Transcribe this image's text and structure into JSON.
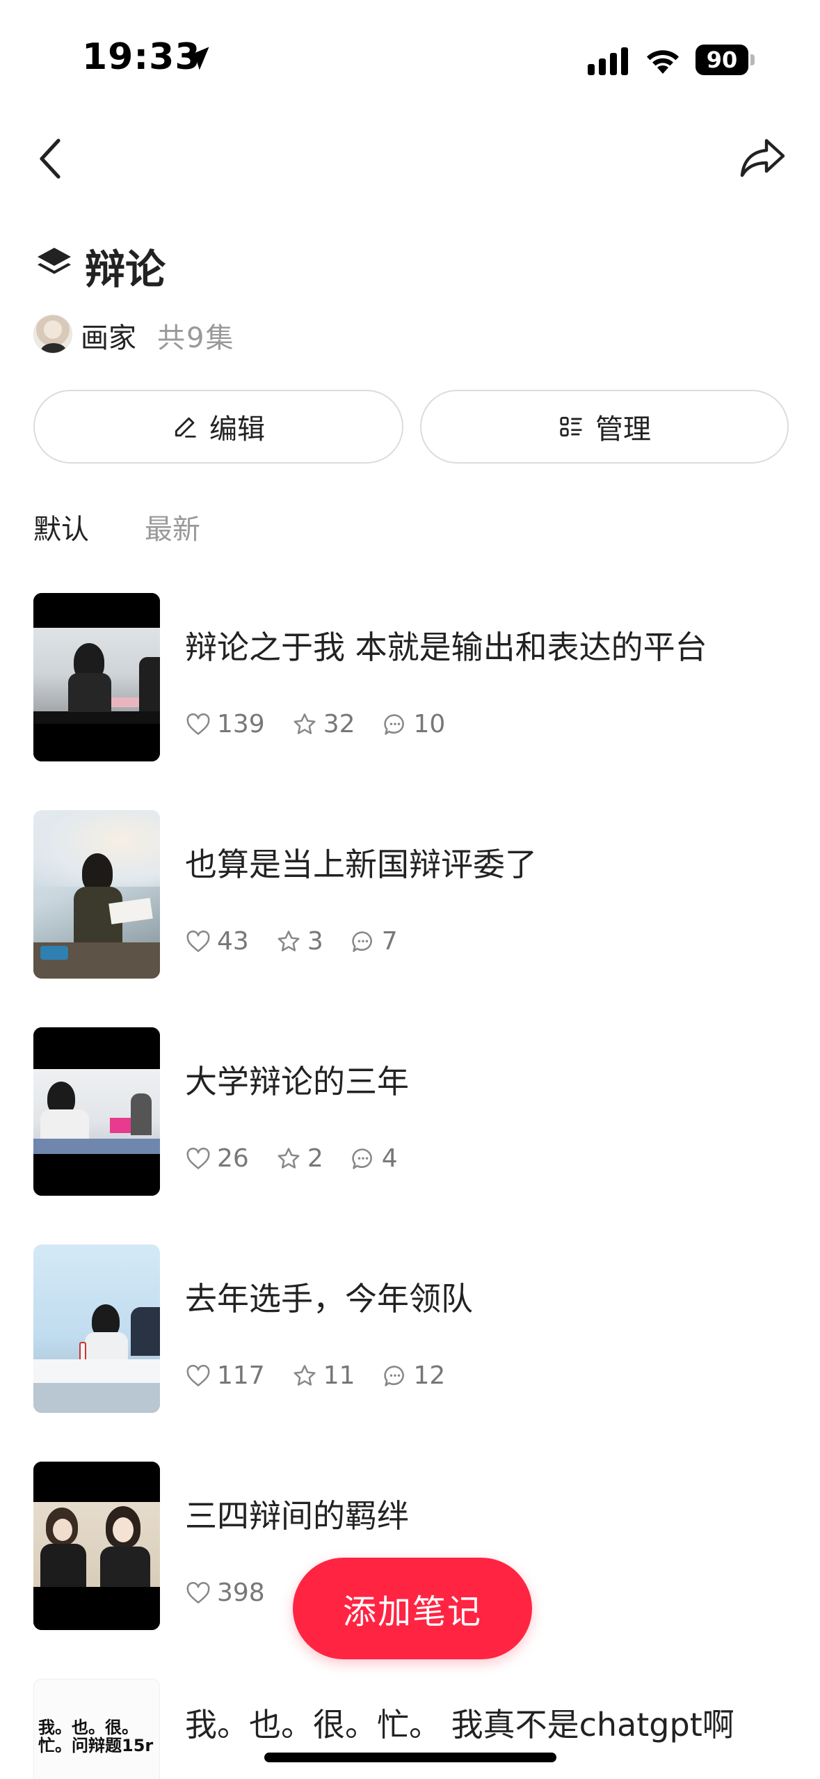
{
  "status_bar": {
    "time": "19:33",
    "battery": "90"
  },
  "header": {
    "title": "辩论"
  },
  "author": {
    "name": "画家",
    "episode_count": "共9集"
  },
  "actions": {
    "edit_label": "编辑",
    "manage_label": "管理"
  },
  "tabs": {
    "default": "默认",
    "latest": "最新"
  },
  "notes": [
    {
      "title": "辩论之于我 本就是输出和表达的平台",
      "likes": "139",
      "stars": "32",
      "comments": "10"
    },
    {
      "title": "也算是当上新国辩评委了",
      "likes": "43",
      "stars": "3",
      "comments": "7"
    },
    {
      "title": "大学辩论的三年",
      "likes": "26",
      "stars": "2",
      "comments": "4"
    },
    {
      "title": "去年选手，今年领队",
      "likes": "117",
      "stars": "11",
      "comments": "12"
    },
    {
      "title": "三四辩间的羁绊",
      "likes": "398"
    },
    {
      "title": "我。也。很。忙。 我真不是chatgpt啊",
      "thumb_text": "我。也。很。忙。问辩题15r"
    }
  ],
  "fab": {
    "label": "添加笔记"
  },
  "colors": {
    "accent": "#ff2442",
    "muted_text": "#999999"
  },
  "icons": [
    "location-arrow-icon",
    "signal-icon",
    "wifi-icon",
    "battery-icon",
    "back-icon",
    "share-icon",
    "collection-icon",
    "pencil-icon",
    "list-icon",
    "heart-icon",
    "star-icon",
    "comment-icon"
  ]
}
